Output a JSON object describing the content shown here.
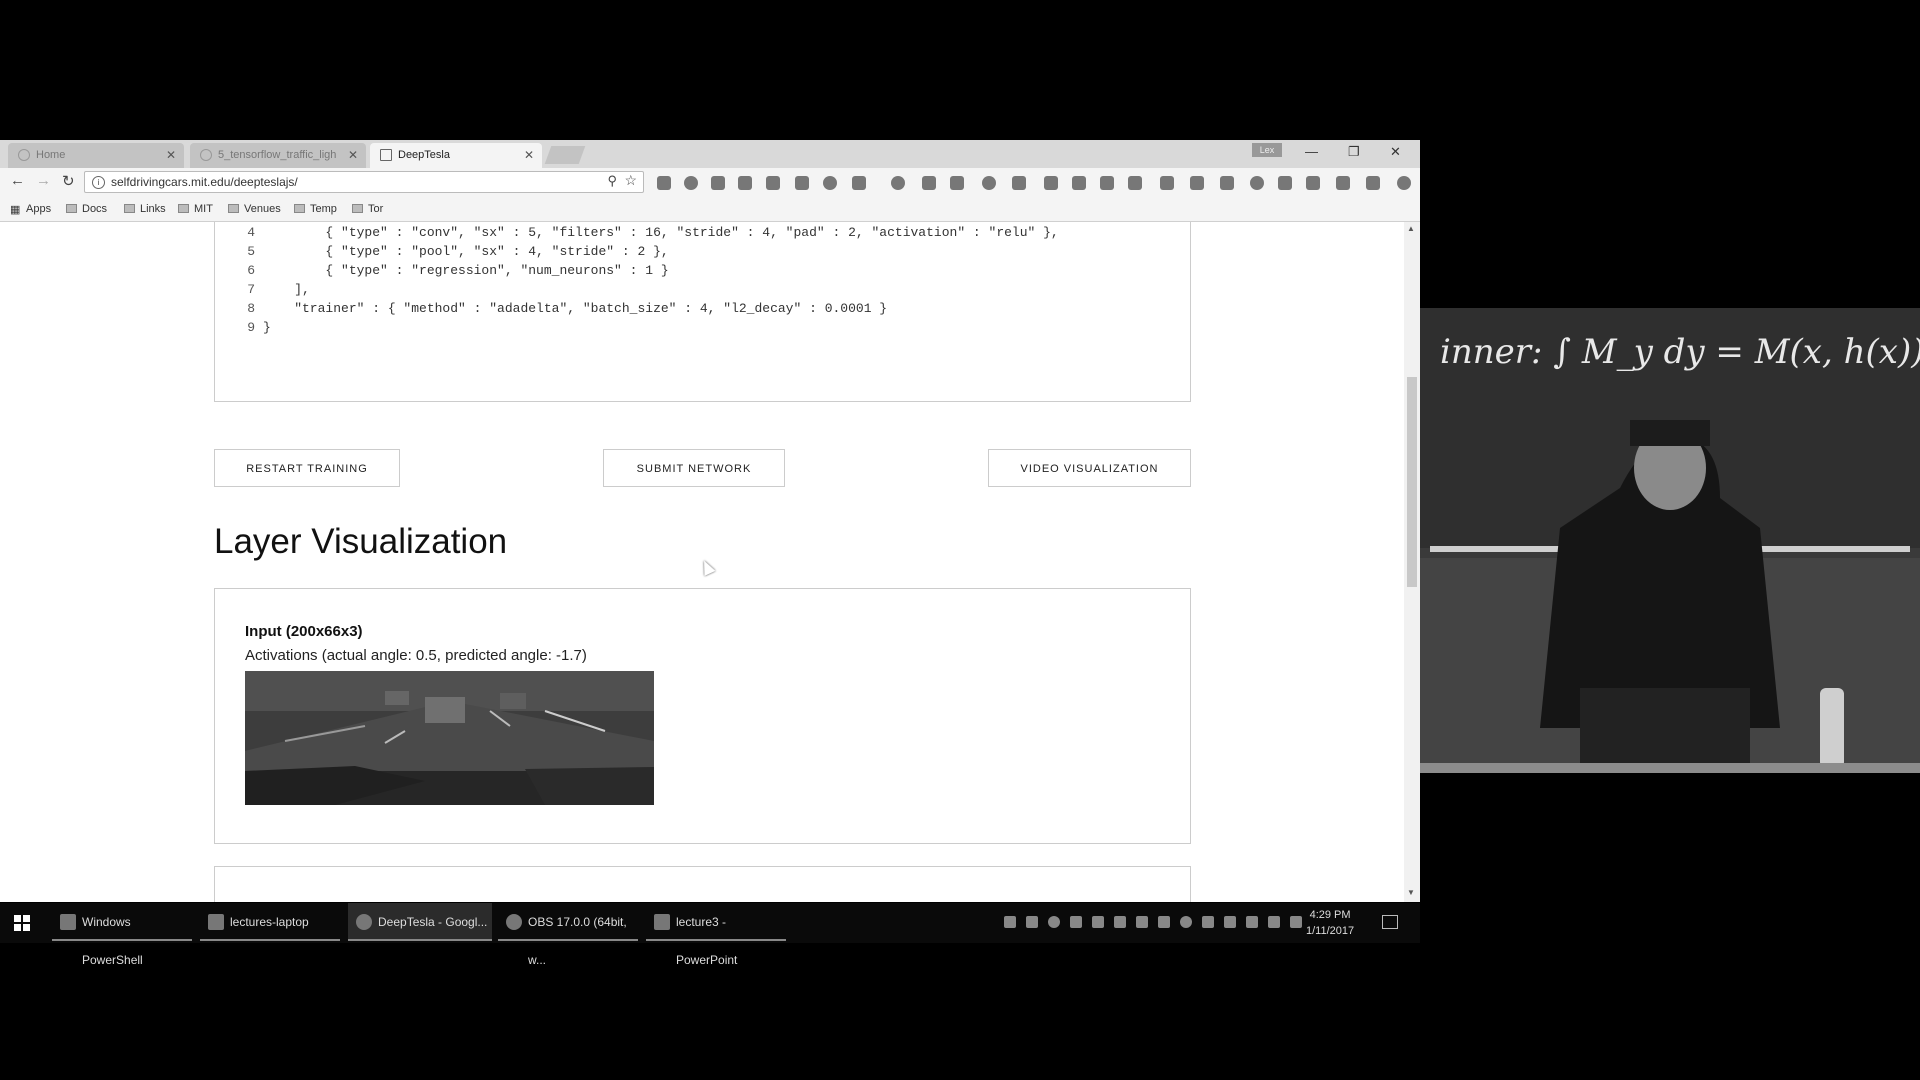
{
  "browser": {
    "tabs": [
      {
        "label": "Home"
      },
      {
        "label": "5_tensorflow_traffic_ligh"
      },
      {
        "label": "DeepTesla"
      }
    ],
    "user_badge": "Lex",
    "url": "selfdrivingcars.mit.edu/deepteslajs/",
    "bookmarks": [
      "Apps",
      "Docs",
      "Links",
      "MIT",
      "Venues",
      "Temp",
      "Tor"
    ]
  },
  "code": {
    "lines": [
      {
        "num": "4",
        "text": "        { \"type\" : \"conv\", \"sx\" : 5, \"filters\" : 16, \"stride\" : 4, \"pad\" : 2, \"activation\" : \"relu\" },"
      },
      {
        "num": "5",
        "text": "        { \"type\" : \"pool\", \"sx\" : 4, \"stride\" : 2 },"
      },
      {
        "num": "6",
        "text": "        { \"type\" : \"regression\", \"num_neurons\" : 1 }"
      },
      {
        "num": "7",
        "text": "    ],"
      },
      {
        "num": "8",
        "text": "    \"trainer\" : { \"method\" : \"adadelta\", \"batch_size\" : 4, \"l2_decay\" : 0.0001 }"
      },
      {
        "num": "9",
        "text": "}"
      }
    ]
  },
  "buttons": {
    "restart": "RESTART TRAINING",
    "submit": "SUBMIT NETWORK",
    "video": "VIDEO VISUALIZATION"
  },
  "layer_viz": {
    "title": "Layer Visualization",
    "input_title": "Input (200x66x3)",
    "activations": "Activations (actual angle: 0.5, predicted angle: -1.7)"
  },
  "video_overlay": {
    "board_text": "inner: ∫ M_y dy = M(x, h(x)) − M(x, a"
  },
  "taskbar": {
    "items": [
      {
        "label": "Windows PowerShell"
      },
      {
        "label": "lectures-laptop"
      },
      {
        "label": "DeepTesla - Googl..."
      },
      {
        "label": "OBS 17.0.0 (64bit, w..."
      },
      {
        "label": "lecture3 - PowerPoint"
      }
    ],
    "time": "4:29 PM",
    "date": "1/11/2017"
  }
}
